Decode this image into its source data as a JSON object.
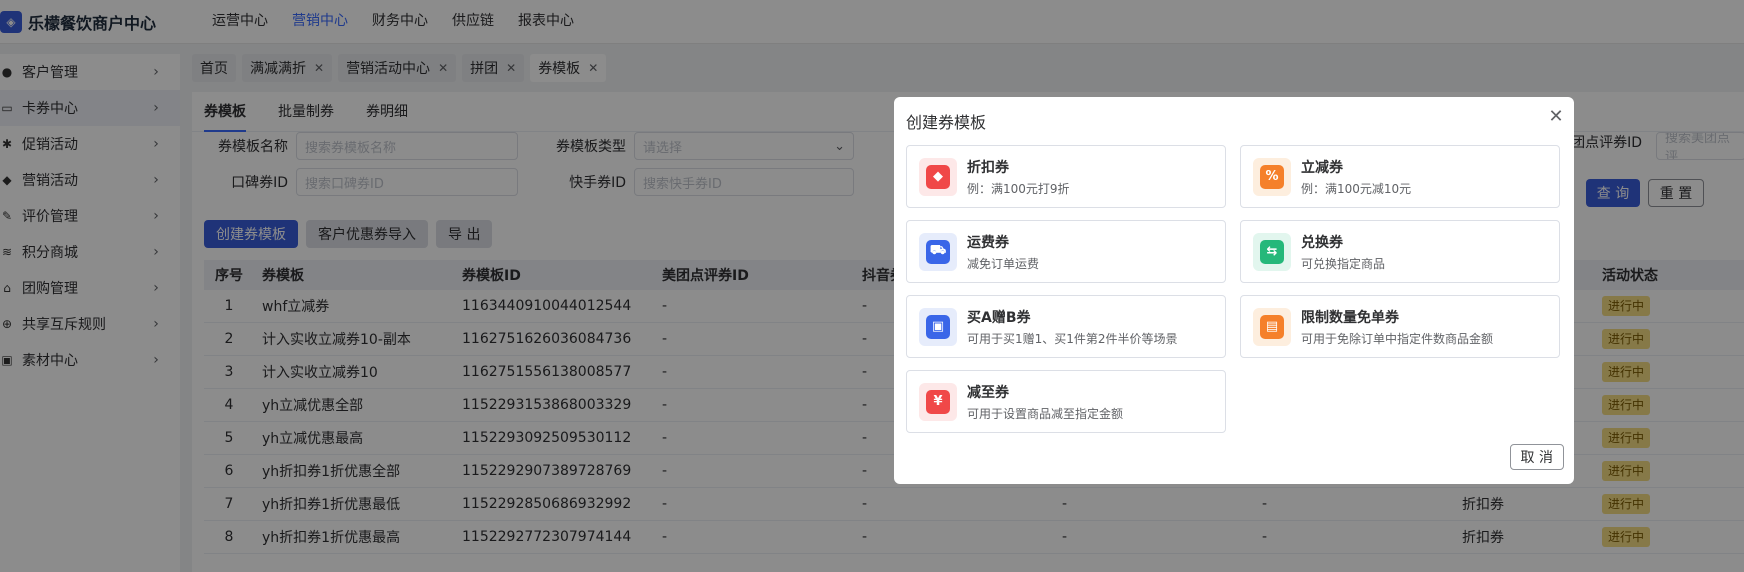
{
  "brand": {
    "name": "乐檬餐饮商户中心"
  },
  "topnav": [
    "运营中心",
    "营销中心",
    "财务中心",
    "供应链",
    "报表中心"
  ],
  "topnav_active": 1,
  "sidebar": [
    {
      "label": "客户管理",
      "icon": "user-icon"
    },
    {
      "label": "卡券中心",
      "icon": "card-icon"
    },
    {
      "label": "促销活动",
      "icon": "gear-icon"
    },
    {
      "label": "营销活动",
      "icon": "tag-icon"
    },
    {
      "label": "评价管理",
      "icon": "edit-icon"
    },
    {
      "label": "积分商城",
      "icon": "stack-icon"
    },
    {
      "label": "团购管理",
      "icon": "shop-icon"
    },
    {
      "label": "共享互斥规则",
      "icon": "share-icon"
    },
    {
      "label": "素材中心",
      "icon": "image-icon"
    }
  ],
  "tabs": [
    {
      "label": "首页",
      "closable": false
    },
    {
      "label": "满减满折",
      "closable": true
    },
    {
      "label": "营销活动中心",
      "closable": true
    },
    {
      "label": "拼团",
      "closable": true
    },
    {
      "label": "券模板",
      "closable": true
    }
  ],
  "subtabs": [
    "券模板",
    "批量制券",
    "券明细"
  ],
  "filters": {
    "template_name_label": "券模板名称",
    "template_name_placeholder": "搜索券模板名称",
    "template_type_label": "券模板类型",
    "template_type_placeholder": "请选择",
    "koubei_label": "口碑券ID",
    "koubei_placeholder": "搜索口碑券ID",
    "kuaishou_label": "快手券ID",
    "kuaishou_placeholder": "搜索快手券ID",
    "meituan_label": "团点评券ID",
    "meituan_placeholder": "搜索美团点评"
  },
  "actions": {
    "create": "创建券模板",
    "import": "客户优惠券导入",
    "export": "导 出",
    "query": "查 询",
    "reset": "重 置"
  },
  "table": {
    "headers": [
      "序号",
      "券模板",
      "券模板ID",
      "美团点评券ID",
      "抖音券",
      "",
      "",
      "",
      "活动状态"
    ],
    "rows": [
      [
        "1",
        "whf立减券",
        "1163440910044012544",
        "-",
        "-",
        "",
        "",
        "",
        "进行中"
      ],
      [
        "2",
        "计入实收立减券10-副本",
        "1162751626036084736",
        "-",
        "-",
        "",
        "",
        "",
        "进行中"
      ],
      [
        "3",
        "计入实收立减券10",
        "1162751556138008577",
        "-",
        "-",
        "",
        "",
        "",
        "进行中"
      ],
      [
        "4",
        "yh立减优惠全部",
        "1152293153868003329",
        "-",
        "-",
        "",
        "",
        "",
        "进行中"
      ],
      [
        "5",
        "yh立减优惠最高",
        "1152293092509530112",
        "-",
        "-",
        "",
        "",
        "",
        "进行中"
      ],
      [
        "6",
        "yh折扣券1折优惠全部",
        "1152292907389728769",
        "-",
        "-",
        "",
        "",
        "",
        "进行中"
      ],
      [
        "7",
        "yh折扣券1折优惠最低",
        "1152292850686932992",
        "-",
        "-",
        "-",
        "-",
        "折扣券",
        "进行中"
      ],
      [
        "8",
        "yh折扣券1折优惠最高",
        "1152292772307974144",
        "-",
        "-",
        "-",
        "-",
        "折扣券",
        "进行中"
      ]
    ]
  },
  "modal": {
    "title": "创建券模板",
    "cancel": "取 消",
    "cards": [
      {
        "title": "折扣券",
        "desc": "例：满100元打9折",
        "icon": "discount-tag-icon",
        "bg": "#fde8e8",
        "fg": "#f04848",
        "glyph": "◆"
      },
      {
        "title": "立减券",
        "desc": "例：满100元减10元",
        "icon": "percent-icon",
        "bg": "#fdeede",
        "fg": "#f5802a",
        "glyph": "%"
      },
      {
        "title": "运费券",
        "desc": "减免订单运费",
        "icon": "cart-icon",
        "bg": "#e6ecfb",
        "fg": "#3a66e8",
        "glyph": "⛟"
      },
      {
        "title": "兑换券",
        "desc": "可兑换指定商品",
        "icon": "exchange-icon",
        "bg": "#e2f6ee",
        "fg": "#25b87a",
        "glyph": "⇆"
      },
      {
        "title": "买A赠B券",
        "desc": "可用于买1赠1、买1件第2件半价等场景",
        "icon": "shopping-bag-icon",
        "bg": "#e6ecfb",
        "fg": "#3a66e8",
        "glyph": "▣"
      },
      {
        "title": "限制数量免单券",
        "desc": "可用于免除订单中指定件数商品金额",
        "icon": "ticket-icon",
        "bg": "#fdeede",
        "fg": "#f5802a",
        "glyph": "▤"
      },
      {
        "title": "减至券",
        "desc": "可用于设置商品减至指定金额",
        "icon": "yen-ticket-icon",
        "bg": "#fde8e8",
        "fg": "#f04848",
        "glyph": "¥"
      }
    ]
  }
}
